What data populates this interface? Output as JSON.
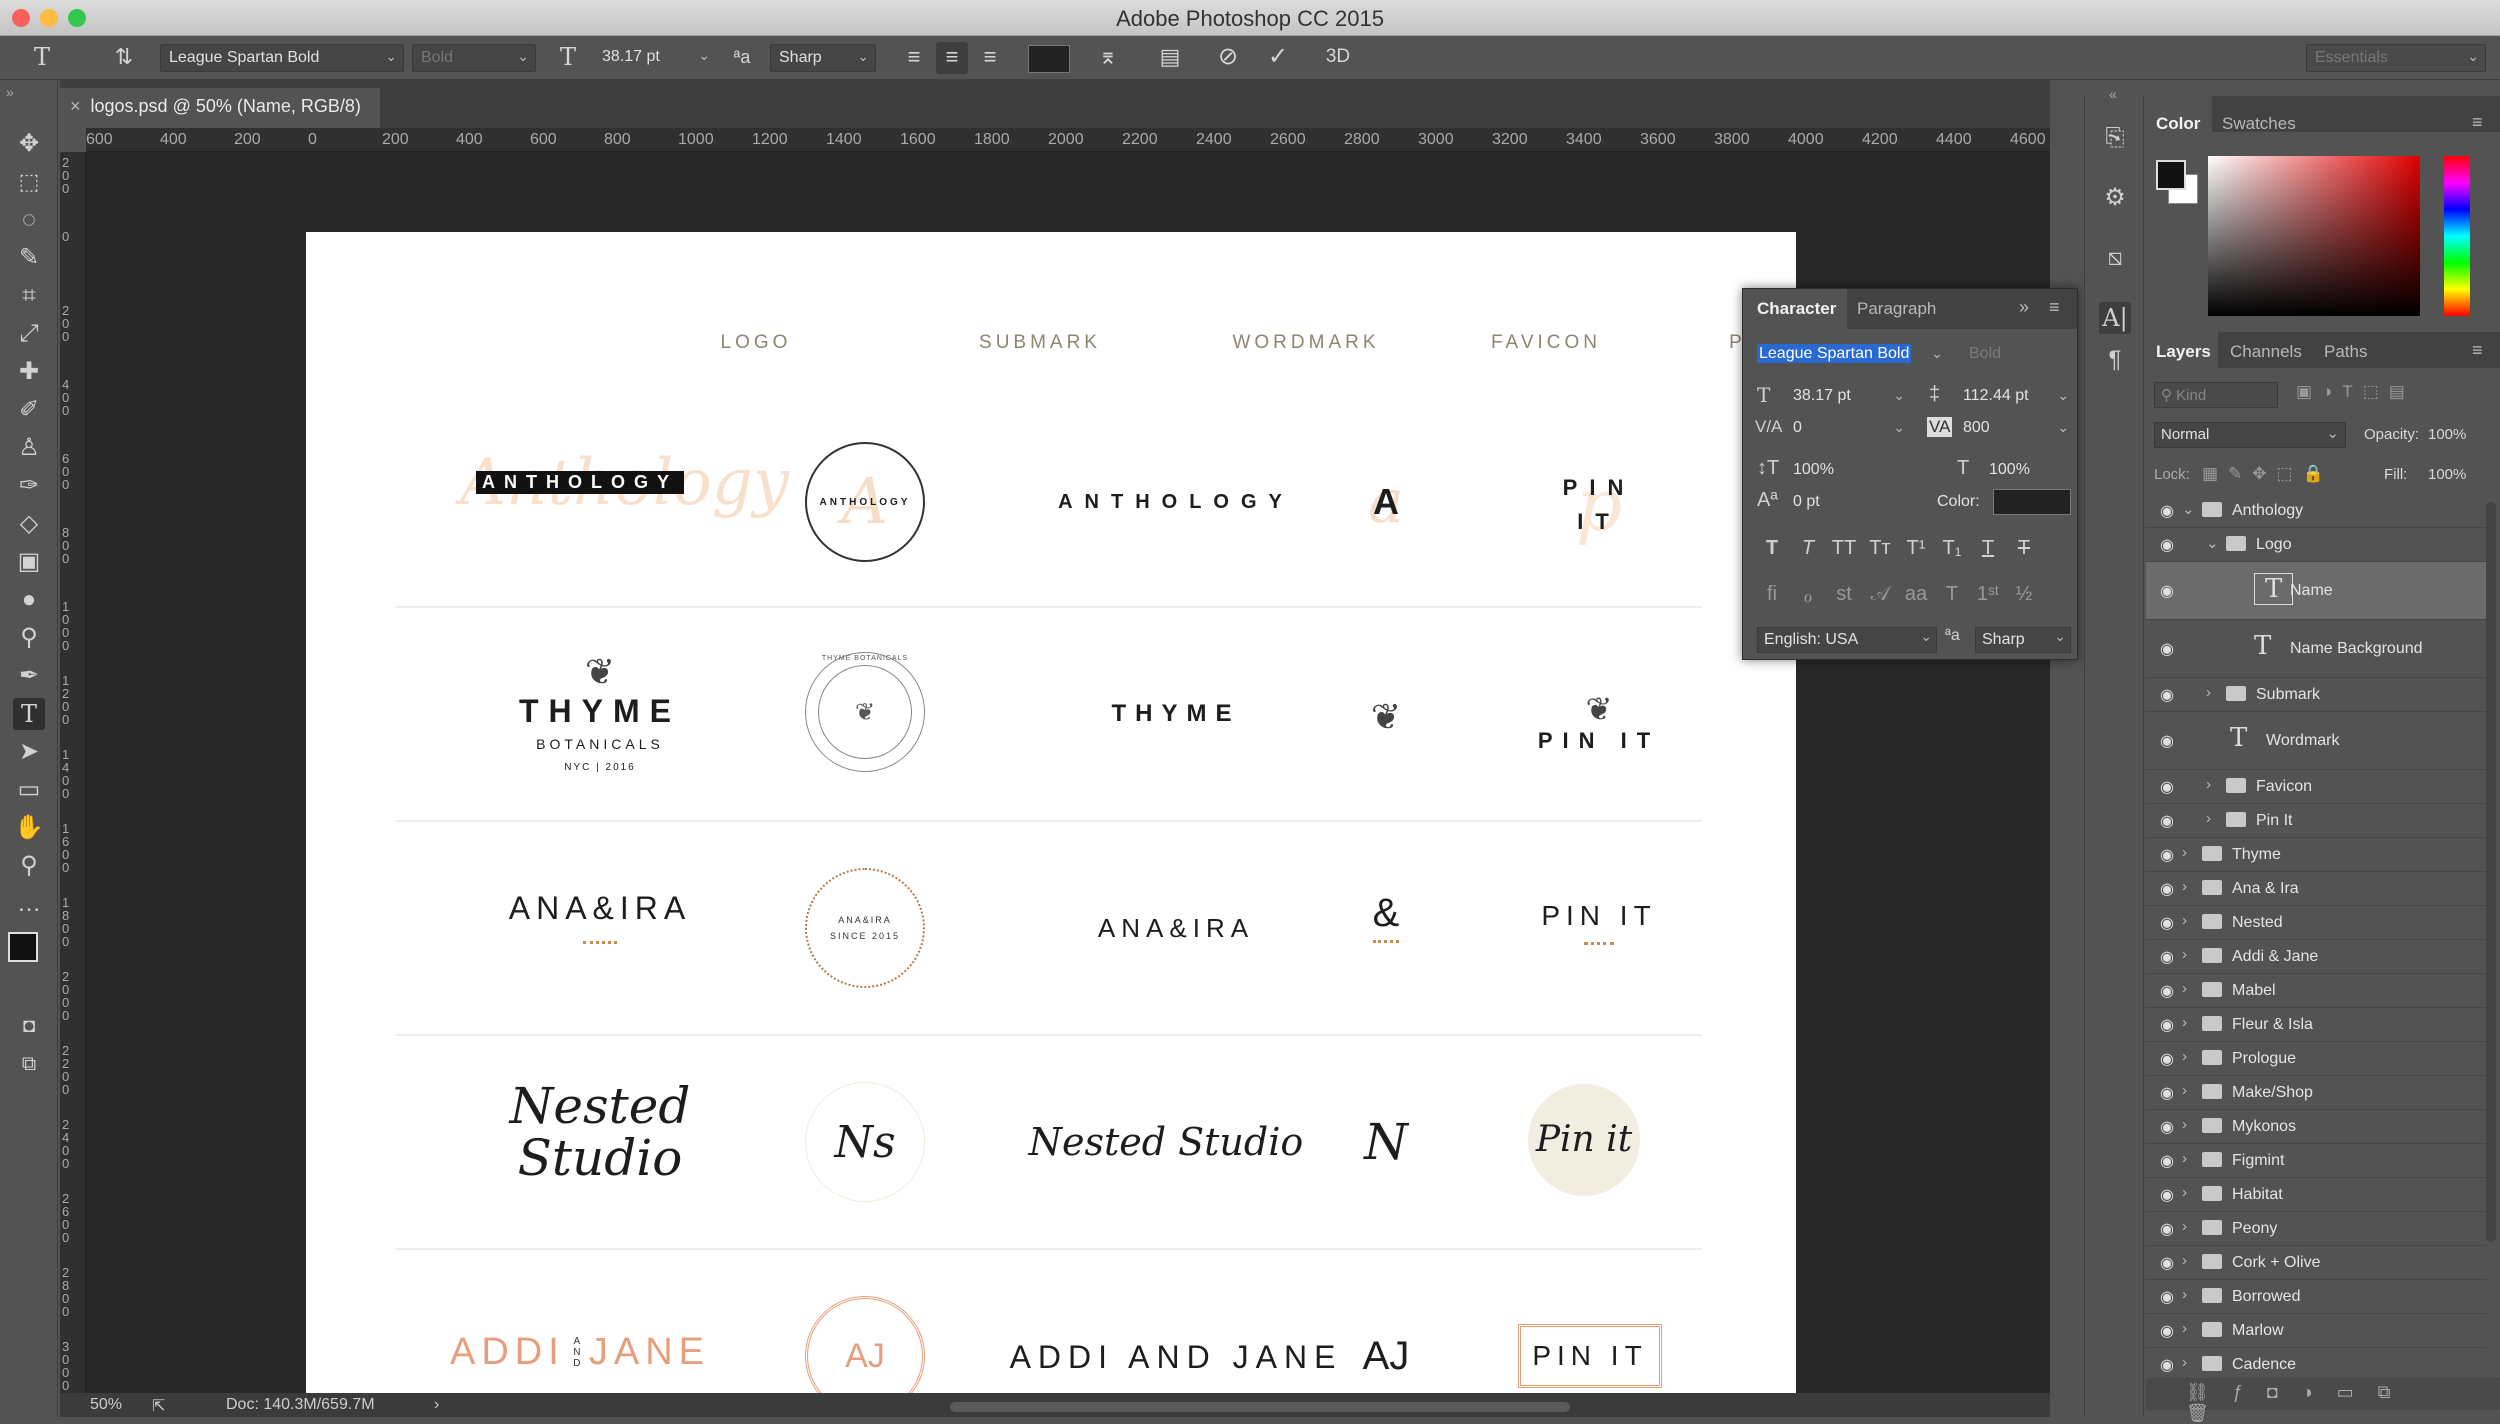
{
  "app": {
    "window_title": "Adobe Photoshop CC 2015"
  },
  "options": {
    "font_family": "League Spartan Bold",
    "font_style": "Bold",
    "font_size": "38.17 pt",
    "antialias": "Sharp",
    "workspace": "Essentials",
    "btn_3d": "3D"
  },
  "document": {
    "tab_title": "logos.psd @ 50% (Name, RGB/8)",
    "zoom": "50%",
    "doc_info": "Doc: 140.3M/659.7M"
  },
  "ruler": {
    "h": [
      "600",
      "400",
      "200",
      "0",
      "200",
      "400",
      "600",
      "800",
      "1000",
      "1200",
      "1400",
      "1600",
      "1800",
      "2000",
      "2200",
      "2400",
      "2600",
      "2800",
      "3000",
      "3200",
      "3400",
      "3600",
      "3800",
      "4000",
      "4200",
      "4400",
      "4600"
    ],
    "v": [
      "200",
      "0",
      "200",
      "400",
      "600",
      "800",
      "1000",
      "1200",
      "1400",
      "1600",
      "1800",
      "2000",
      "2200",
      "2400",
      "2600",
      "2800",
      "3000"
    ]
  },
  "artboard": {
    "headers": [
      "LOGO",
      "SUBMARK",
      "WORDMARK",
      "FAVICON",
      "PIN IT"
    ],
    "rows": [
      {
        "logo": "ANTHOLOGY",
        "submark": "ANTHOLOGY",
        "wordmark": "ANTHOLOGY",
        "favicon": "A",
        "pin": "PIN IT"
      },
      {
        "logo": "THYME",
        "logo_sub": "BOTANICALS",
        "logo_sub2": "NYC | 2016",
        "submark": "THYME BOTANICALS",
        "wordmark": "THYME",
        "favicon": "",
        "pin": "PIN IT"
      },
      {
        "logo": "ANA&IRA",
        "submark": "ANA&IRA SINCE 2015",
        "wordmark": "ANA&IRA",
        "favicon": "&",
        "pin": "PIN IT"
      },
      {
        "logo": "Nested Studio",
        "submark": "Ns",
        "wordmark": "Nested Studio",
        "favicon": "N",
        "pin": "Pin it"
      },
      {
        "logo_left": "ADDI",
        "logo_and": "AND",
        "logo_right": "JANE",
        "submark": "AJ",
        "wordmark": "ADDI AND JANE",
        "favicon": "AJ",
        "pin": "PIN IT"
      }
    ]
  },
  "character": {
    "tabs": [
      "Character",
      "Paragraph"
    ],
    "font_family": "League Spartan Bold",
    "font_style": "Bold",
    "size": "38.17 pt",
    "leading": "112.44 pt",
    "kerning": "0",
    "tracking": "800",
    "vscale": "100%",
    "hscale": "100%",
    "baseline": "0 pt",
    "color_label": "Color:",
    "language": "English: USA",
    "antialias": "Sharp"
  },
  "color_panel": {
    "tabs": [
      "Color",
      "Swatches"
    ]
  },
  "layers_panel": {
    "tabs": [
      "Layers",
      "Channels",
      "Paths"
    ],
    "filter": "Kind",
    "blend_mode": "Normal",
    "opacity_label": "Opacity:",
    "opacity": "100%",
    "lock_label": "Lock:",
    "fill_label": "Fill:",
    "fill": "100%",
    "layers": [
      "Anthology",
      "Logo",
      "Name",
      "Name Background",
      "Submark",
      "Wordmark",
      "Favicon",
      "Pin It",
      "Thyme",
      "Ana & Ira",
      "Nested",
      "Addi & Jane",
      "Mabel",
      "Fleur & Isla",
      "Prologue",
      "Make/Shop",
      "Mykonos",
      "Figmint",
      "Habitat",
      "Peony",
      "Cork + Olive",
      "Borrowed",
      "Marlow",
      "Cadence"
    ]
  },
  "colors": {
    "accent_peach": "#f4c9a4",
    "select_blue": "#2a6ad0",
    "pin_circle": "#f1ede0"
  }
}
